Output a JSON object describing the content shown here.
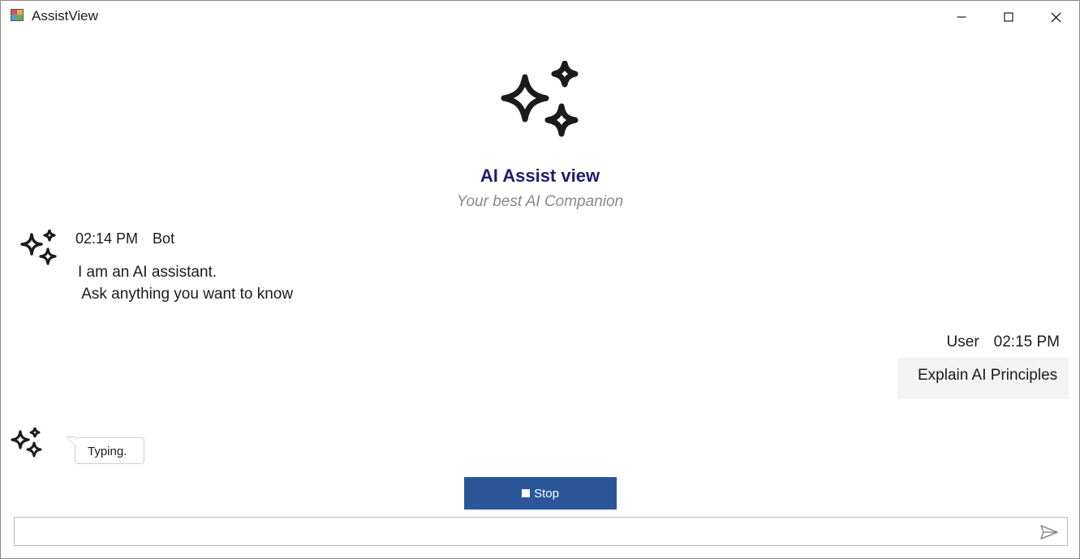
{
  "window": {
    "title": "AssistView",
    "controls": [
      "minimize-icon",
      "maximize-icon",
      "close-icon"
    ]
  },
  "banner": {
    "icon": "sparkles-icon",
    "title": "AI Assist view",
    "subtitle": "Your best AI Companion"
  },
  "messages": [
    {
      "author": "Bot",
      "time": "02:14 PM",
      "avatar": "sparkles-icon",
      "text": "I am an AI assistant.\n Ask anything you want to know"
    },
    {
      "author": "User",
      "time": "02:15 PM",
      "text": "Explain AI Principles"
    }
  ],
  "typing_indicator": {
    "avatar": "sparkles-icon",
    "text": "Typing."
  },
  "stop_button": {
    "label": "Stop",
    "icon": "stop-square-icon"
  },
  "input": {
    "value": "",
    "placeholder": "",
    "send_icon": "send-icon"
  },
  "colors": {
    "banner_title": "#1d1d6e",
    "subtitle": "#8a8a8a",
    "stop_button": "#2b579a",
    "user_bubble": "#f3f3f3"
  }
}
